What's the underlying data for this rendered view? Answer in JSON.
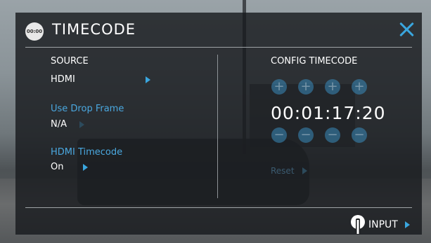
{
  "header": {
    "logo_text": "00:00",
    "title": "TIMECODE"
  },
  "source": {
    "heading": "SOURCE",
    "value": "HDMI"
  },
  "drop_frame": {
    "label": "Use Drop Frame",
    "value": "N/A"
  },
  "hdmi_timecode": {
    "label": "HDMI Timecode",
    "value": "On"
  },
  "config": {
    "heading": "CONFIG TIMECODE",
    "timecode": "00:01:17:20",
    "reset_label": "Reset",
    "plus_symbol": "+",
    "minus_symbol": "−"
  },
  "footer": {
    "input_label": "INPUT"
  },
  "colors": {
    "accent": "#3aa6de",
    "panel": "#181b1e"
  }
}
